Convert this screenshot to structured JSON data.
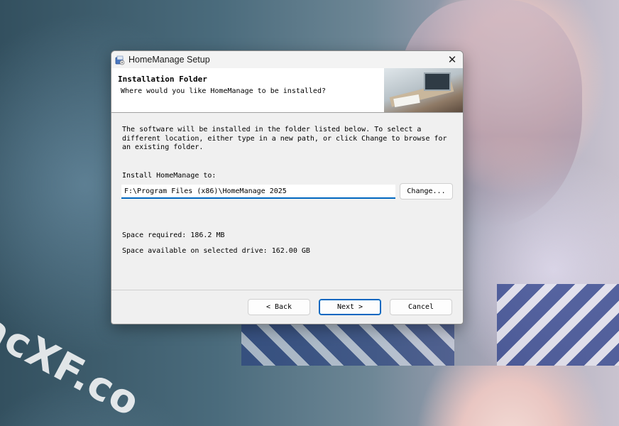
{
  "background": {
    "watermark": "acXF.co"
  },
  "window": {
    "title": "HomeManage Setup",
    "close_glyph": "✕"
  },
  "banner": {
    "title": "Installation Folder",
    "subtitle": "Where would you like HomeManage to be installed?"
  },
  "content": {
    "description": "The software will be installed in the folder listed below. To select a\ndifferent location, either type in a new path, or click Change to browse for\nan existing folder.",
    "install_label": "Install HomeManage to:",
    "path_value": "F:\\Program Files (x86)\\HomeManage 2025",
    "change_button": "Change...",
    "space_required": "Space required: 186.2 MB",
    "space_available": "Space available on selected drive: 162.00 GB"
  },
  "buttons": {
    "back": "< Back",
    "next": "Next >",
    "cancel": "Cancel"
  },
  "icons": {
    "app": "installer-icon",
    "close": "close-icon"
  },
  "colors": {
    "accent": "#0067c0",
    "dialog_bg": "#f0f0f0",
    "banner_bg": "#ffffff"
  }
}
